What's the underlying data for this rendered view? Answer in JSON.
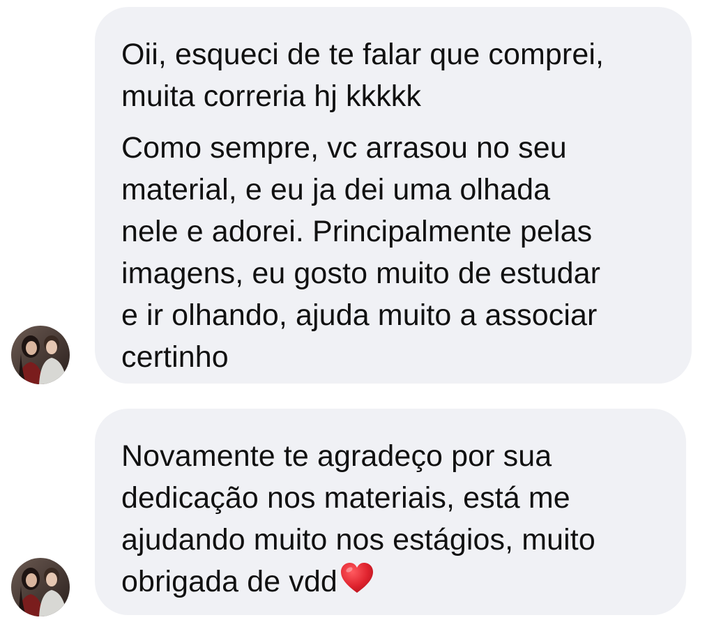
{
  "conversation": {
    "messages": [
      {
        "paragraphs": [
          {
            "lines": [
              "Oii, esqueci de te falar que comprei,",
              "muita correria hj kkkkk"
            ]
          },
          {
            "lines": [
              "Como sempre, vc arrasou no seu",
              "material, e eu ja dei uma olhada",
              "nele e adorei. Principalmente pelas",
              "imagens, eu gosto muito de estudar",
              "e ir olhando, ajuda muito a associar",
              "certinho"
            ]
          }
        ]
      },
      {
        "paragraphs": [
          {
            "lines": [
              "Novamente te agradeço por sua",
              "dedicação nos materiais, está me",
              "ajudando muito nos estágios, muito",
              "obrigada de vdd"
            ],
            "trailing_emoji": "heart-emoji"
          }
        ]
      }
    ],
    "colors": {
      "bubble_background": "#f0f1f5",
      "text": "#111111",
      "heart": "#e0242f"
    },
    "avatar_icon": "profile-photo-avatar"
  }
}
